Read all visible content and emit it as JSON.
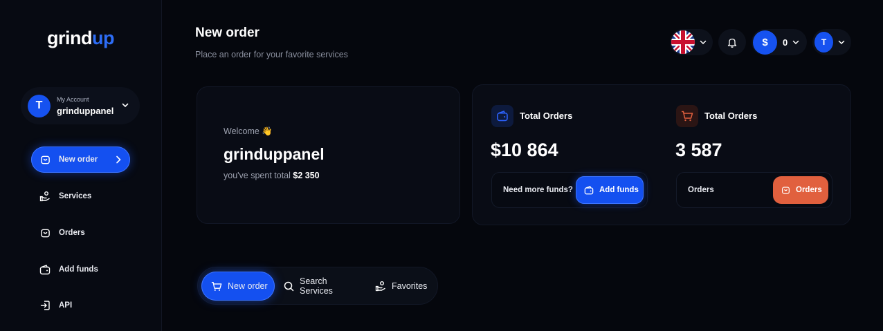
{
  "brand": {
    "part1": "grind",
    "part2": "up"
  },
  "account": {
    "label": "My Account",
    "name": "grinduppanel",
    "initial": "T"
  },
  "sidebar": {
    "items": [
      {
        "label": "New order",
        "icon": "cart-icon",
        "active": true
      },
      {
        "label": "Services",
        "icon": "hand-coins-icon"
      },
      {
        "label": "Orders",
        "icon": "bag-icon"
      },
      {
        "label": "Add funds",
        "icon": "wallet-icon"
      },
      {
        "label": "API",
        "icon": "login-icon"
      }
    ]
  },
  "header": {
    "title": "New order",
    "subtitle": "Place an order for your favorite services",
    "balance": "0",
    "currency_symbol": "$",
    "user_initial": "T"
  },
  "welcome": {
    "greeting": "Welcome 👋",
    "name": "grinduppanel",
    "spent_prefix": "you've spent total",
    "spent_amount": "$2 350"
  },
  "stats": [
    {
      "title": "Total Orders",
      "value": "$10 864",
      "box_label": "Need more funds?",
      "button_label": "Add funds",
      "accent": "#1652f0"
    },
    {
      "title": "Total Orders",
      "value": "3 587",
      "box_label": "Orders",
      "button_label": "Orders",
      "accent": "#e1603e"
    }
  ],
  "tabs": [
    {
      "label": "New order",
      "icon": "cart-icon",
      "active": true
    },
    {
      "label": "Search Services",
      "icon": "search-icon"
    },
    {
      "label": "Favorites",
      "icon": "hand-coins-icon"
    }
  ],
  "colors": {
    "primary": "#1652f0",
    "orange": "#e1603e",
    "background": "#05070d"
  }
}
